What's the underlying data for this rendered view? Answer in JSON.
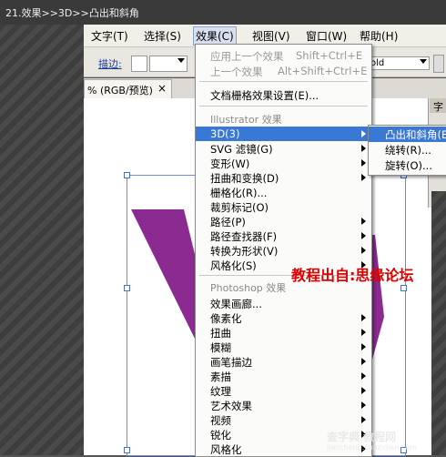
{
  "caption": "21.效果>>3D>>凸出和斜角",
  "menubar": {
    "items": [
      "文字(T)",
      "选择(S)",
      "效果(C)",
      "视图(V)",
      "窗口(W)",
      "帮助(H)"
    ]
  },
  "toolbar": {
    "stroke_label": "描边:",
    "font_style_value": "old"
  },
  "document_tab": {
    "title": "% (RGB/预览)",
    "close": "×"
  },
  "effect_menu": {
    "apply_last": {
      "label": "应用上一个效果",
      "shortcut": "Shift+Ctrl+E"
    },
    "last_effect": {
      "label": "上一个效果",
      "shortcut": "Alt+Shift+Ctrl+E"
    },
    "doc_raster_settings": "文档栅格效果设置(E)...",
    "illustrator_header": "Illustrator 效果",
    "illustrator_items": [
      "3D(3)",
      "SVG 滤镜(G)",
      "变形(W)",
      "扭曲和变换(D)",
      "栅格化(R)...",
      "裁剪标记(O)",
      "路径(P)",
      "路径查找器(F)",
      "转换为形状(V)",
      "风格化(S)"
    ],
    "photoshop_header": "Photoshop 效果",
    "photoshop_items": [
      "效果画廊...",
      "像素化",
      "扭曲",
      "模糊",
      "画笔描边",
      "素描",
      "纹理",
      "艺术效果",
      "视频",
      "锐化",
      "风格化"
    ]
  },
  "submenu_3d": {
    "items": [
      "凸出和斜角(E)...",
      "绕转(R)...",
      "旋转(O)..."
    ]
  },
  "overlay": {
    "source_text": "教程出自:思缘论坛",
    "site_name": "查字典 教程网",
    "site_url": "jiaocheng.chazidian.com"
  },
  "right_panel": {
    "label": "字"
  },
  "colors": {
    "highlight": "#3a78d6",
    "artwork_purple": "#8b2a90",
    "watermark_red": "#e00000"
  }
}
